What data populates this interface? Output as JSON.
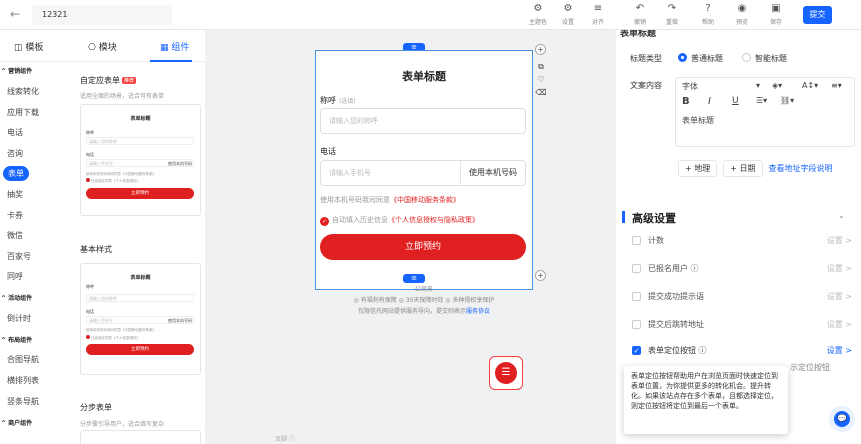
{
  "header": {
    "back_icon": "back-arrow-icon",
    "title_value": "12321",
    "tools": [
      {
        "label": "主题色",
        "icon": "theme-icon"
      },
      {
        "label": "设置",
        "icon": "settings-icon"
      },
      {
        "label": "对齐",
        "icon": "align-icon"
      },
      {
        "label": "撤销",
        "icon": "undo-icon"
      },
      {
        "label": "重做",
        "icon": "redo-icon"
      },
      {
        "label": "帮助",
        "icon": "help-icon"
      },
      {
        "label": "预览",
        "icon": "preview-icon"
      },
      {
        "label": "保存",
        "icon": "save-icon"
      }
    ],
    "submit_label": "提交"
  },
  "left_tabs": [
    {
      "label": "◫ 模板"
    },
    {
      "label": "⎔ 模块"
    },
    {
      "label": "▦ 组件"
    }
  ],
  "categories": {
    "marketing_head": "^ 营销组件",
    "marketing": [
      "线索转化",
      "应用下载",
      "电话",
      "咨询"
    ],
    "active": "表单",
    "marketing2": [
      "抽奖",
      "卡券",
      "微信",
      "百家号",
      "同呼"
    ],
    "activity_head": "^ 活动组件",
    "activity": [
      "倒计时"
    ],
    "layout_head": "^ 布局组件",
    "layout": [
      "合图导航",
      "横排列表",
      "竖条导航"
    ],
    "business_head": "^ 商户组件"
  },
  "thumbs": {
    "sec1_title": "自定应表单",
    "sec1_badge": "推荐",
    "sec1_sub": "适用全面的场景，适合可有表单",
    "card_title": "表单标题",
    "field_name": "称呼",
    "field_name_ph": "请输入您的称呼",
    "field_phone": "电话",
    "field_phone_ph": "请输入手机号",
    "phone_btn": "使用本机号码",
    "note": "使用本机号码我司同意《中国移动服务条款》",
    "agree": "已阅读并同意《个人信息授权》",
    "btn": "立即预约",
    "sec2_title": "基本样式",
    "sec3_title": "分步表单",
    "sec3_sub": "分步骤引导用户，适合填写复杂"
  },
  "form": {
    "title": "表单标题",
    "name_label": "称呼",
    "name_optional": "(选填)",
    "name_placeholder": "请输入您的称呼",
    "phone_label": "电话",
    "phone_placeholder": "请输入手机号",
    "phone_btn": "使用本机号码",
    "note_prefix": "使用本机号码我司同意",
    "note_link": "《中国移动服务条款》",
    "agree_prefix": "自动填入历史信息",
    "agree_link": "《个人信息授权与隐私政策》",
    "submit": "立即预约"
  },
  "footer": {
    "brand": "公司名",
    "line1": "◎ 有福利有保障  ◎ 30天保障时效  ◎ 多种授权享保护",
    "line2_prefix": "仅限信托网站提供服务导向，提交则表示",
    "line2_link": "服务协议",
    "canvas_note": "页脚 ⓘ"
  },
  "right": {
    "section_title": "表单标题",
    "title_type_label": "标题类型",
    "type_normal": "普通标题",
    "type_smart": "智能标题",
    "content_label": "文案内容",
    "font_name": "字体",
    "text_value": "表单标题",
    "add_address": "+ 地理",
    "add_date": "+ 日期",
    "view_link": "查看地址字段说明",
    "adv_title": "高级设置",
    "options": [
      {
        "label": "计数",
        "set": "设置 >",
        "checked": false
      },
      {
        "label": "已报名用户 ⓘ",
        "set": "设置 >",
        "checked": false
      },
      {
        "label": "提交成功提示语",
        "set": "设置 >",
        "checked": false
      },
      {
        "label": "提交后跳转地址",
        "set": "设置 >",
        "checked": false
      },
      {
        "label": "表单定位按钮 ⓘ",
        "set": "设置 >",
        "checked": true
      }
    ],
    "trailing_text": "示定位按钮",
    "tooltip": "表单定位按钮帮助用户在浏览页面时快速定位到表单位置，为你提供更多的转化机会。提升转化。如果该站点存在多个表单，且都选择定位，则定位按钮将定位到最后一个表单。",
    "cs_icon": "customer-service-icon"
  }
}
